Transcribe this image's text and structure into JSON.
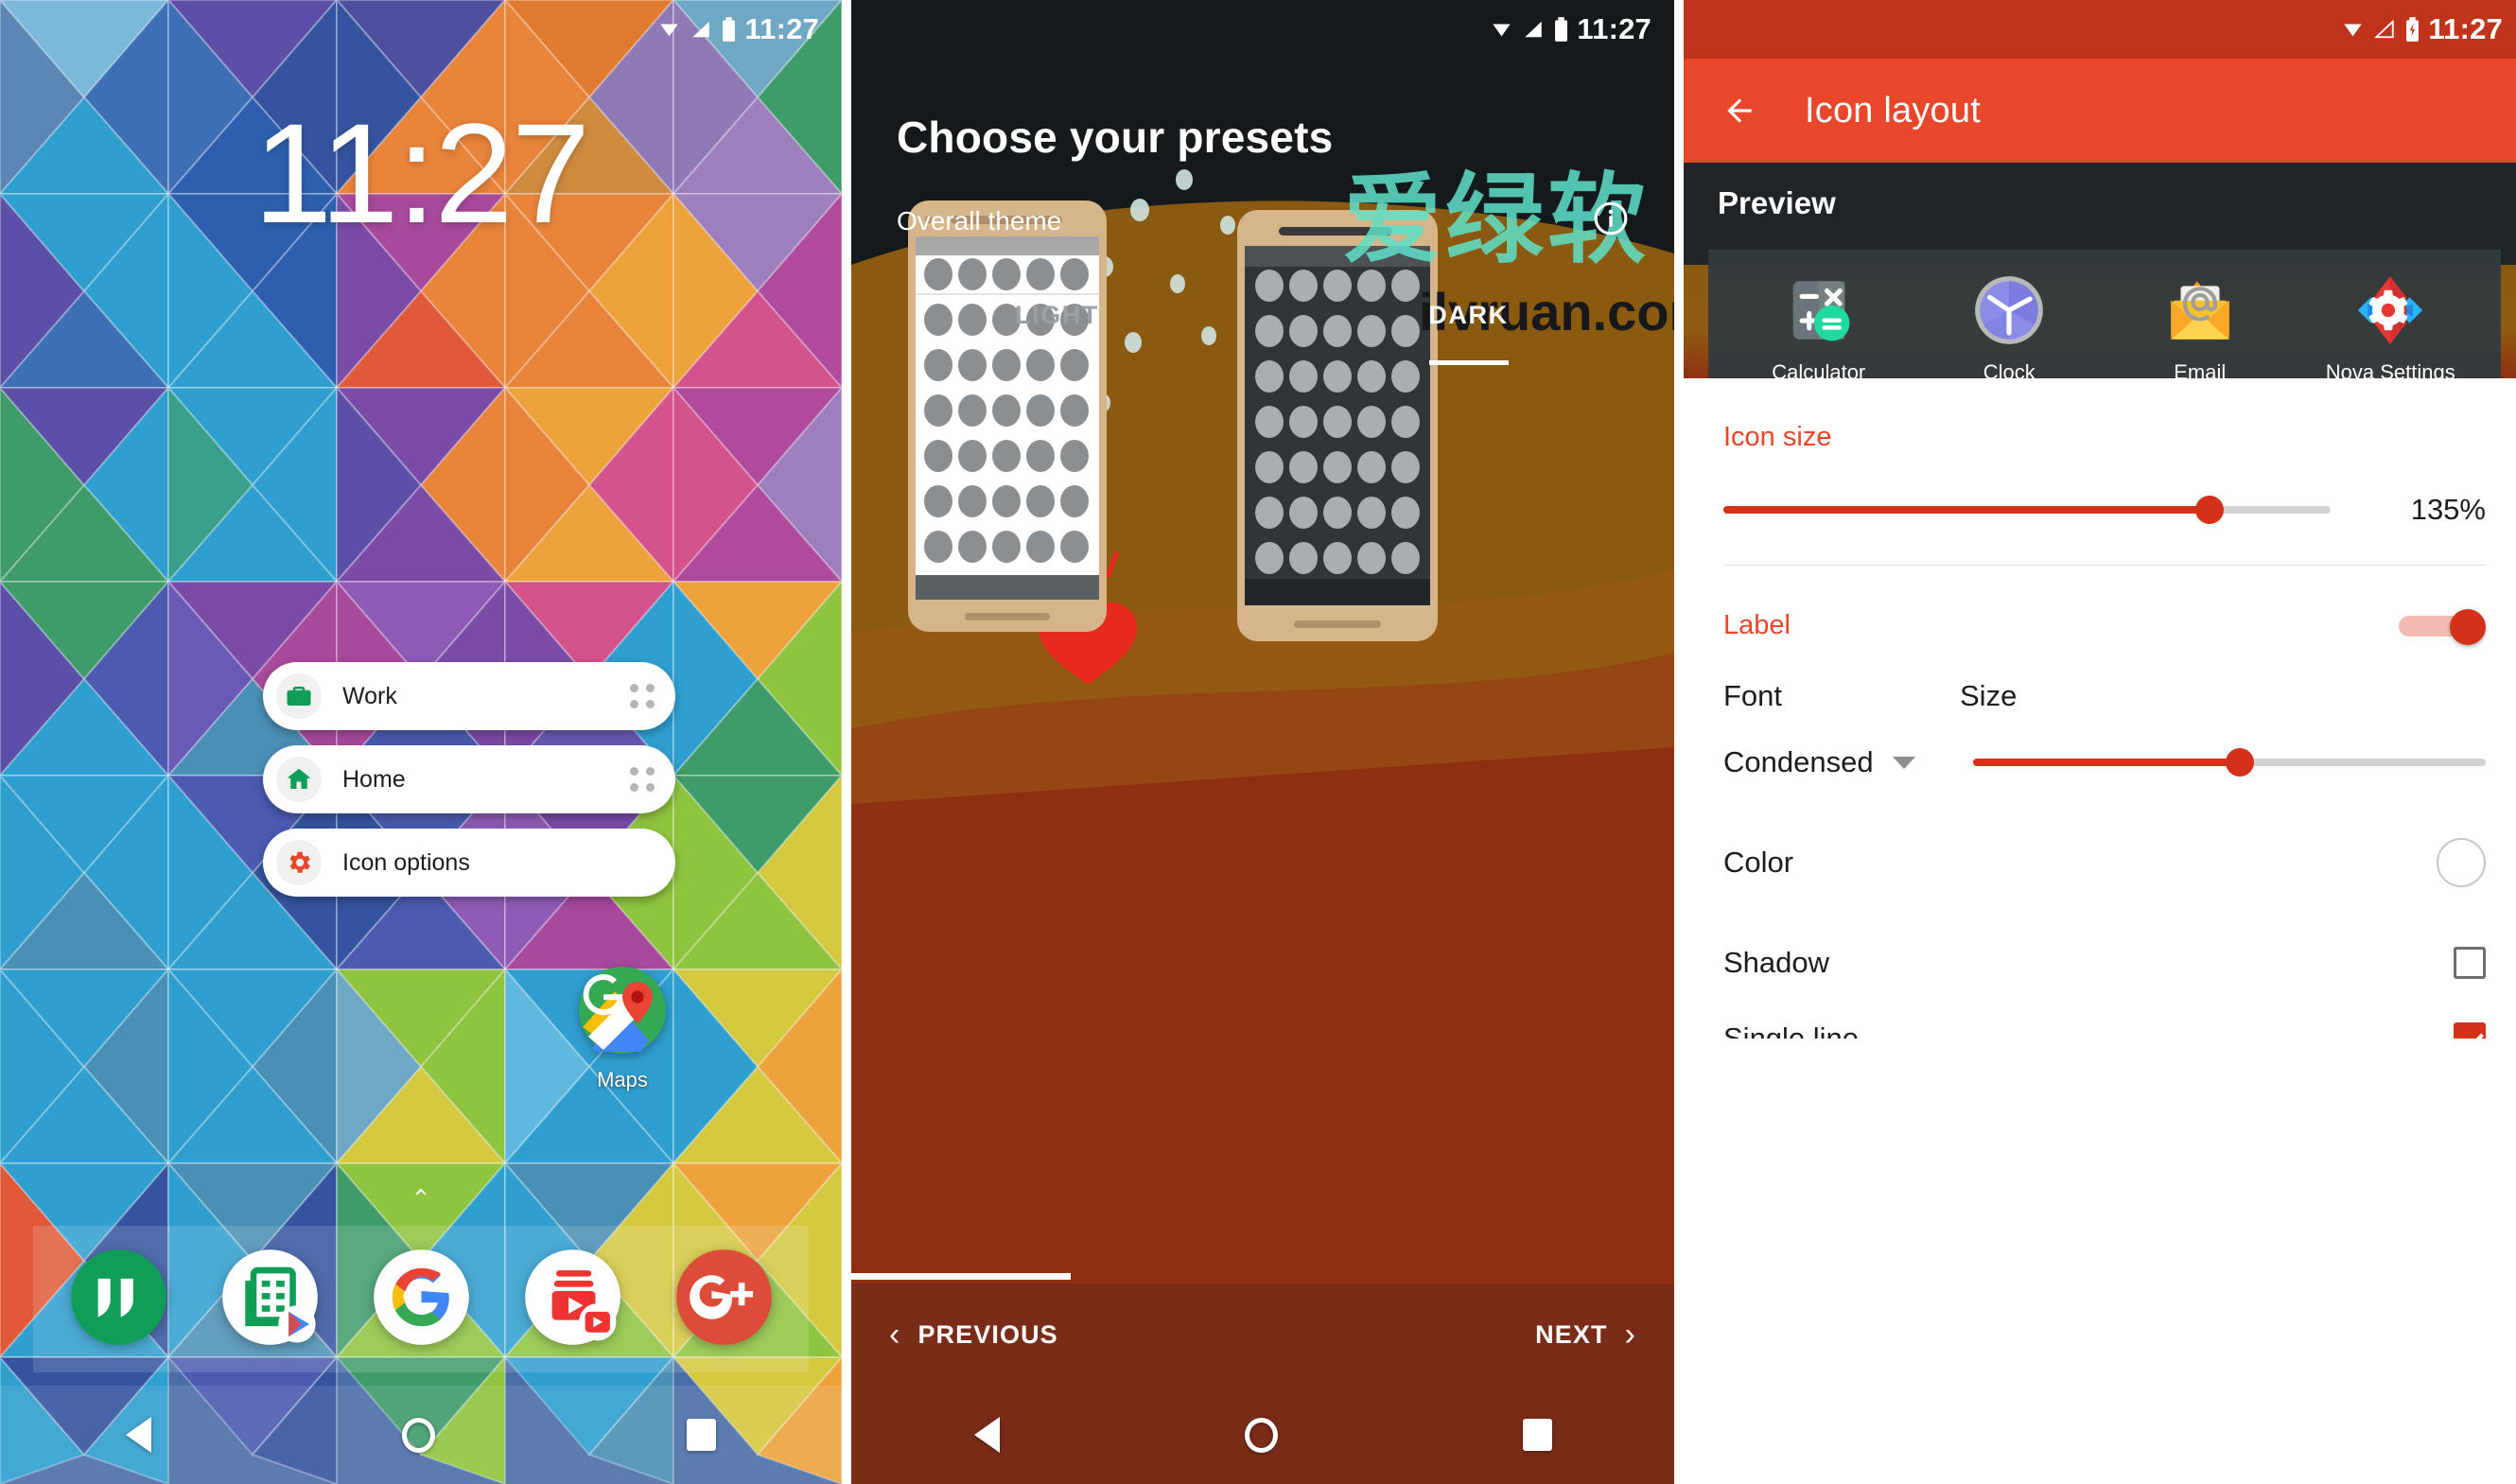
{
  "panels": {
    "home": {
      "status": {
        "time": "11:27",
        "icons": [
          "wifi-icon",
          "signal-icon",
          "battery-icon"
        ]
      },
      "clock_widget": {
        "time": "11:27"
      },
      "shortcuts": [
        {
          "label": "Work",
          "icon": "briefcase-icon",
          "icon_color": "#0f9d58"
        },
        {
          "label": "Home",
          "icon": "house-icon",
          "icon_color": "#0f9d58"
        },
        {
          "label": "Icon options",
          "icon": "gear-icon",
          "icon_color": "#e8472b"
        }
      ],
      "app_icon": {
        "label": "Maps",
        "icon": "google-maps-icon"
      },
      "page_up_hint": "⌃",
      "dock": [
        {
          "name": "Hangouts",
          "icon": "hangouts-icon"
        },
        {
          "name": "Sheets",
          "icon": "sheets-icon"
        },
        {
          "name": "Google",
          "icon": "google-icon"
        },
        {
          "name": "Play Music",
          "icon": "play-music-icon"
        },
        {
          "name": "Google Plus",
          "icon": "google-plus-icon"
        }
      ],
      "navbar": [
        "back-icon",
        "home-icon",
        "recents-icon"
      ]
    },
    "presets": {
      "status": {
        "time": "11:27"
      },
      "title": "Choose your presets",
      "subtitle": "Overall theme",
      "info_icon": "info-icon",
      "tabs": [
        {
          "label": "LIGHT",
          "active": false
        },
        {
          "label": "DARK",
          "active": true
        }
      ],
      "footer": {
        "previous": "PREVIOUS",
        "next": "NEXT"
      },
      "navbar": [
        "back-icon",
        "home-icon",
        "recents-icon"
      ],
      "watermark": {
        "cn": "爱绿软",
        "url": "ilvruan.com"
      }
    },
    "icon_layout": {
      "status": {
        "time": "11:27",
        "icons": [
          "wifi-icon",
          "signal-icon",
          "battery-charging-icon"
        ]
      },
      "appbar": {
        "back_icon": "back-arrow-icon",
        "title": "Icon layout"
      },
      "preview": {
        "heading": "Preview",
        "apps": [
          {
            "label": "Calculator",
            "icon": "calculator-icon"
          },
          {
            "label": "Clock",
            "icon": "clock-icon"
          },
          {
            "label": "Email",
            "icon": "email-icon"
          },
          {
            "label": "Nova Settings",
            "icon": "nova-settings-icon"
          }
        ]
      },
      "icon_size": {
        "heading": "Icon size",
        "value": "135%",
        "percent": 80
      },
      "label": {
        "heading": "Label",
        "toggle_on": true
      },
      "font": {
        "header": "Font",
        "value": "Condensed"
      },
      "size": {
        "header": "Size",
        "percent": 52
      },
      "color": {
        "label": "Color",
        "swatch": "#ffffff"
      },
      "shadow": {
        "label": "Shadow",
        "checked": false
      },
      "single_line": {
        "label": "Single line",
        "checked": true
      },
      "accent": "#e8472b"
    }
  }
}
